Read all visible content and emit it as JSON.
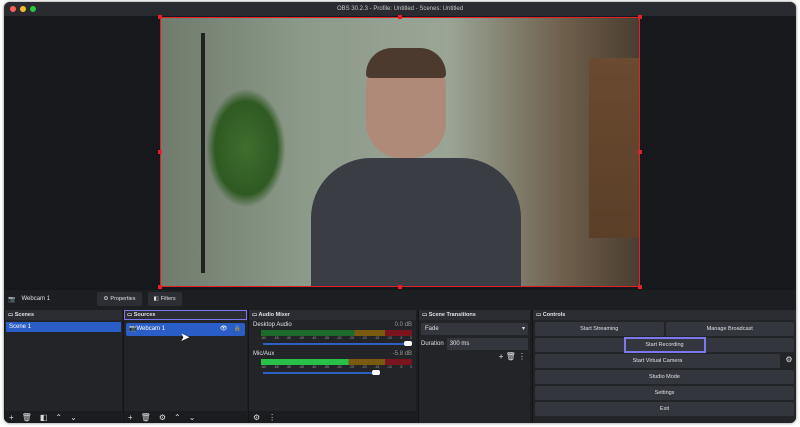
{
  "window": {
    "title": "OBS 30.2.3 - Profile: Untitled - Scenes: Untitled"
  },
  "source_toolbar": {
    "source_name": "Webcam 1",
    "properties": "Properties",
    "filters": "Filters"
  },
  "scenes": {
    "title": "Scenes",
    "items": [
      "Scene 1"
    ]
  },
  "sources": {
    "title": "Sources",
    "items": [
      {
        "name": "Webcam 1",
        "visible": true,
        "locked": false
      }
    ]
  },
  "audio_mixer": {
    "title": "Audio Mixer",
    "ticks": [
      "-60",
      "-55",
      "-50",
      "-45",
      "-40",
      "-35",
      "-30",
      "-25",
      "-20",
      "-15",
      "-10",
      "-5",
      "0"
    ],
    "channels": [
      {
        "name": "Desktop Audio",
        "db": "0.0 dB",
        "volume": 1.0
      },
      {
        "name": "Mic/Aux",
        "db": "-5.8 dB",
        "volume": 0.8
      }
    ]
  },
  "transitions": {
    "title": "Scene Transitions",
    "selected": "Fade",
    "duration_label": "Duration",
    "duration": "300 ms"
  },
  "controls": {
    "title": "Controls",
    "start_streaming": "Start Streaming",
    "manage_broadcast": "Manage Broadcast",
    "start_recording": "Start Recording",
    "start_virtual_camera": "Start Virtual Camera",
    "studio_mode": "Studio Mode",
    "settings": "Settings",
    "exit": "Exit"
  },
  "colors": {
    "accent": "#2a5dc5",
    "highlight": "#7d77f0",
    "selection_border": "#e0202a"
  }
}
